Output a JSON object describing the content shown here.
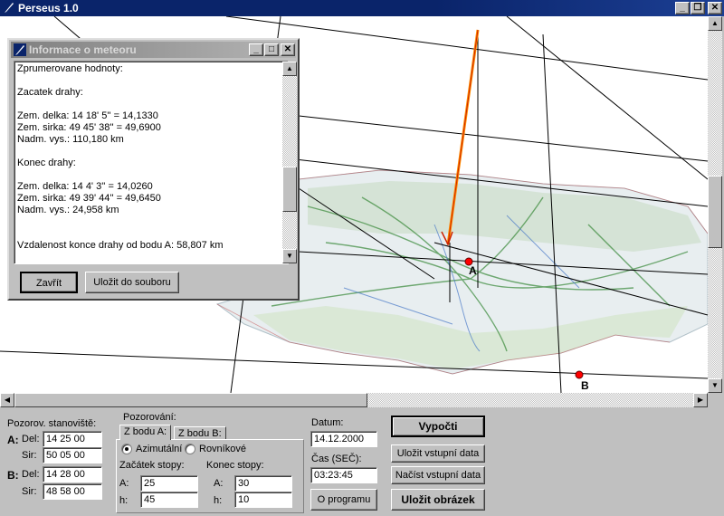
{
  "window": {
    "title": "Perseus 1.0"
  },
  "dialog": {
    "title": "Informace o meteoru",
    "lines": [
      "Zprumerovane hodnoty:",
      "",
      "Zacatek drahy:",
      "",
      "Zem. delka: 14 18' 5'' = 14,1330",
      "Zem. sirka: 49 45' 38'' = 49,6900",
      "Nadm. vys.: 110,180 km",
      "",
      "Konec drahy:",
      "",
      "Zem. delka: 14 4' 3'' = 14,0260",
      "Zem. sirka: 49 39' 44'' = 49,6450",
      "Nadm. vys.: 24,958 km",
      "",
      "",
      "Vzdalenost konce drahy od bodu A: 58,807 km"
    ],
    "close_label": "Zavřít",
    "save_label": "Uložit do souboru"
  },
  "map": {
    "point_a_label": "A",
    "point_b_label": "B",
    "colors": {
      "trajectory": "#ff8c00",
      "trajectory_inner": "#cc2200",
      "points": "#ff0000"
    }
  },
  "stations": {
    "heading": "Pozorov. stanoviště:",
    "a_label": "A:",
    "b_label": "B:",
    "del_label": "Del:",
    "sir_label": "Sir:",
    "a_del": "14 25 00",
    "a_sir": "50 05 00",
    "b_del": "14 28 00",
    "b_sir": "48 58 00"
  },
  "observation": {
    "heading": "Pozorování:",
    "tabs": [
      "Z bodu A:",
      "Z bodu B:"
    ],
    "radio_azimutalni": "Azimutální",
    "radio_rovnikove": "Rovníkové",
    "start_heading": "Začátek stopy:",
    "end_heading": "Konec stopy:",
    "a_label": "A:",
    "h_label": "h:",
    "start_a": "25",
    "start_h": "45",
    "end_a": "30",
    "end_h": "10"
  },
  "datetime": {
    "date_label": "Datum:",
    "date_value": "14.12.2000",
    "time_label": "Čas (SEČ):",
    "time_value": "03:23:45"
  },
  "buttons": {
    "about": "O programu",
    "compute": "Vypočti",
    "save_input": "Uložit vstupní data",
    "load_input": "Načíst vstupní data",
    "save_image": "Uložit obrázek"
  }
}
